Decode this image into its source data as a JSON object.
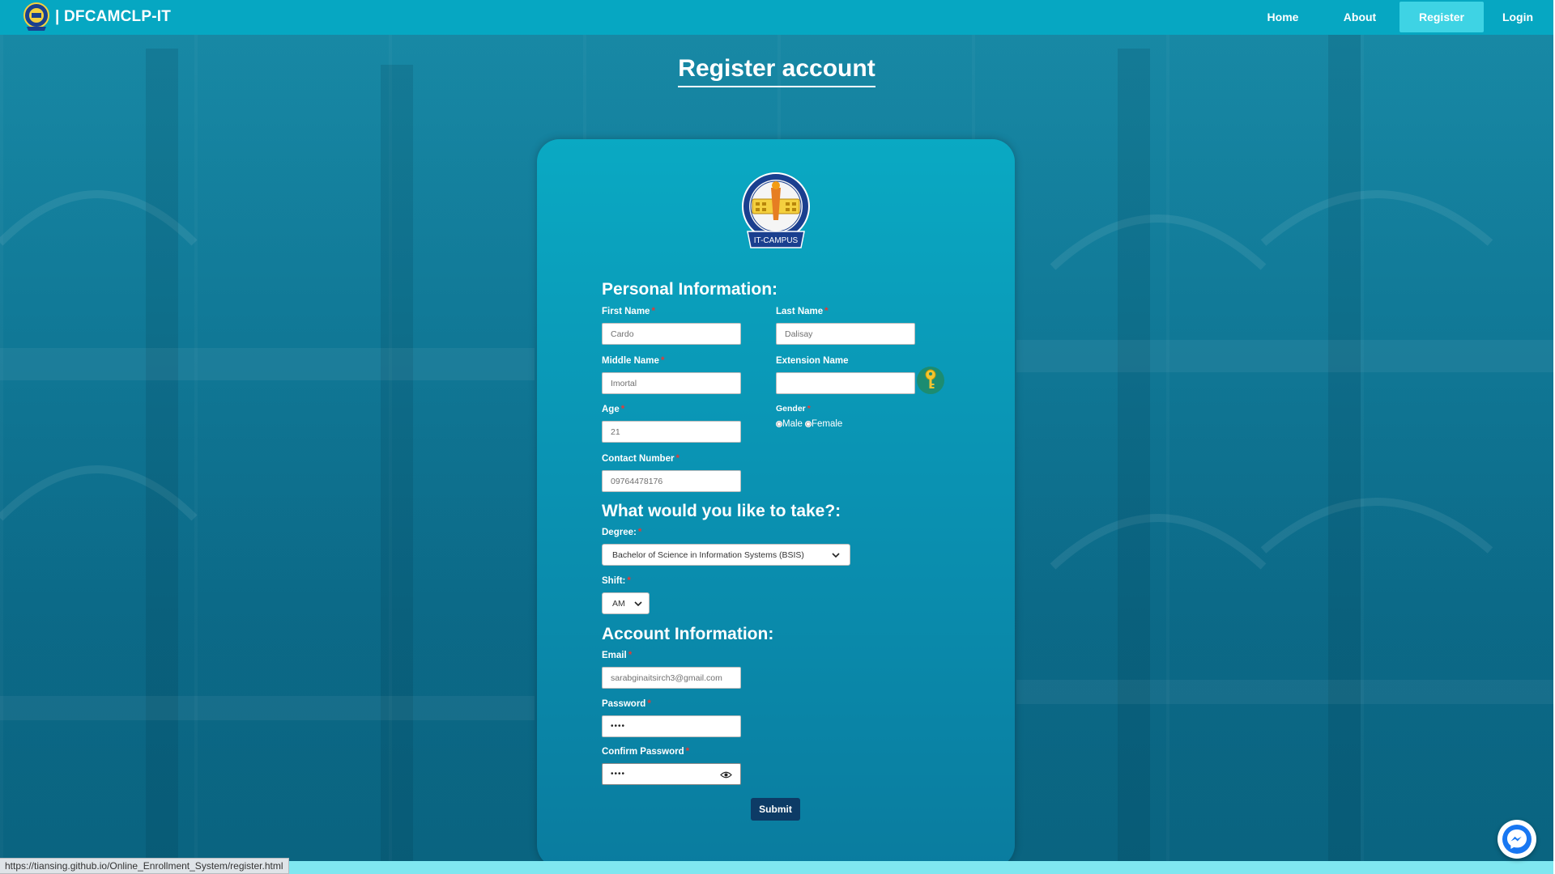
{
  "browser": {
    "status_url": "https://tiansing.github.io/Online_Enrollment_System/register.html"
  },
  "navbar": {
    "brand": "| DFCAMCLP-IT",
    "links": [
      {
        "label": "Home",
        "active": false
      },
      {
        "label": "About",
        "active": false
      },
      {
        "label": "Register",
        "active": true
      },
      {
        "label": "Login",
        "active": false
      }
    ]
  },
  "page": {
    "title": "Register account"
  },
  "form": {
    "logo_caption": "IT-CAMPUS",
    "personal": {
      "heading": "Personal Information:",
      "first_name": {
        "label": "First Name",
        "value": "Cardo"
      },
      "last_name": {
        "label": "Last Name",
        "value": "Dalisay"
      },
      "middle_name": {
        "label": "Middle Name",
        "value": "Imortal"
      },
      "extension_name": {
        "label": "Extension Name",
        "value": ""
      },
      "age": {
        "label": "Age",
        "value": "21"
      },
      "gender": {
        "label": "Gender",
        "options": [
          "Male",
          "Female"
        ],
        "selected": "Female"
      },
      "contact": {
        "label": "Contact Number",
        "value": "09764478176"
      }
    },
    "course": {
      "heading": "What would you like to take?:",
      "degree": {
        "label": "Degree:",
        "value": "Bachelor of Science in Information Systems (BSIS)"
      },
      "shift": {
        "label": "Shift:",
        "value": "AM"
      }
    },
    "account": {
      "heading": "Account Information:",
      "email": {
        "label": "Email",
        "value": "sarabginaitsirch3@gmail.com"
      },
      "password": {
        "label": "Password",
        "value": "••••"
      },
      "confirm_password": {
        "label": "Confirm Password",
        "value": "••••"
      }
    },
    "submit_label": "Submit"
  },
  "colors": {
    "navbar": "#06a7c2",
    "nav_active": "#3ed3e4",
    "card": "#0a93b3",
    "submit": "#0d3b66",
    "required": "#e53935"
  }
}
